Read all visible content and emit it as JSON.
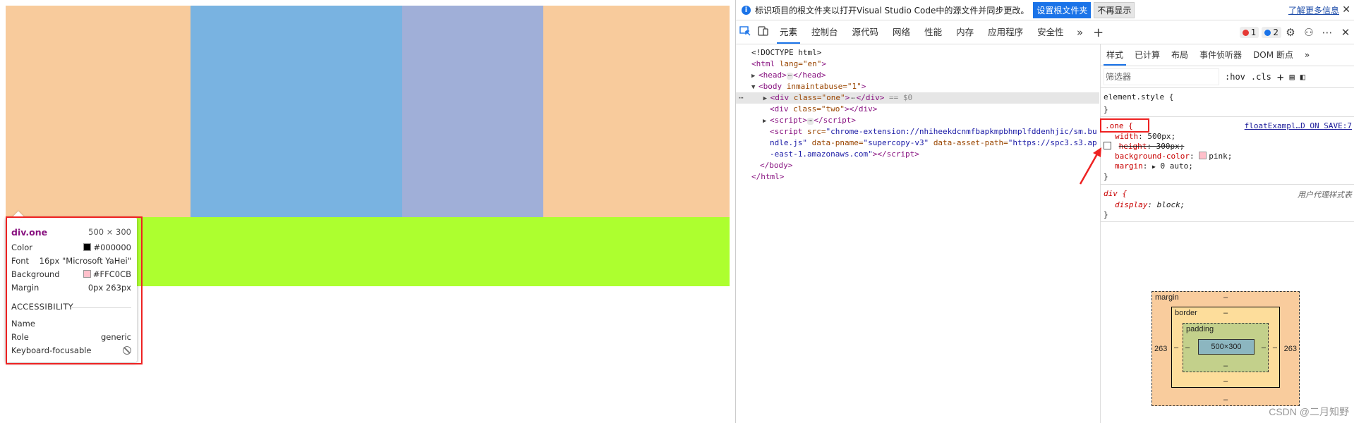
{
  "preview": {
    "tooltip": {
      "selector": "div.one",
      "size": "500 × 300",
      "rows": [
        {
          "label": "Color",
          "value": "#000000",
          "swatch": "#000000"
        },
        {
          "label": "Font",
          "value": "16px \"Microsoft YaHei\""
        },
        {
          "label": "Background",
          "value": "#FFC0CB",
          "swatch": "#FFC0CB"
        },
        {
          "label": "Margin",
          "value": "0px 263px"
        }
      ],
      "accessibility_title": "ACCESSIBILITY",
      "a11y": [
        {
          "label": "Name",
          "value": ""
        },
        {
          "label": "Role",
          "value": "generic"
        },
        {
          "label": "Keyboard-focusable",
          "value": ""
        }
      ]
    },
    "colors": {
      "margin": "#f8cb9c",
      "content": "#79b3e1",
      "padding": "#a0afd8",
      "two": "#adff2f"
    }
  },
  "infobar": {
    "message": "标识项目的根文件夹以打开Visual Studio Code中的源文件并同步更改。",
    "set_root_button": "设置根文件夹",
    "dismiss_button": "不再显示",
    "learn_more": "了解更多信息",
    "close": "✕"
  },
  "tabs": [
    "元素",
    "控制台",
    "源代码",
    "网络",
    "性能",
    "内存",
    "应用程序",
    "安全性"
  ],
  "active_tab": "元素",
  "badges": {
    "errors": "1",
    "messages": "2"
  },
  "dom": [
    {
      "text": "<!DOCTYPE html>"
    },
    {
      "tag": "html",
      "attrs": "lang=\"en\""
    },
    {
      "tag": "head"
    },
    {
      "tag": "body",
      "attrs": "inmaintabuse=\"1\""
    },
    {
      "tag": "div",
      "attrs": "class=\"one\"",
      "suffix": "== $0"
    },
    {
      "tag": "div",
      "attrs": "class=\"two\""
    },
    {
      "tag": "script"
    },
    {
      "script_src": "chrome-extension://nhiheekdcnmfbapkmpbhmplfddenhjic/sm.bundle.js",
      "script_src_line1": "\"chrome-extension://nhiheekdcnmfbapkmpbhmplfddenhjic/sm.bu",
      "script_src_line2": "ndle.js\"",
      "pname": "\"supercopy-v3\"",
      "asset_path_line1": "\"https://spc3.s3.ap",
      "asset_path_line2": "-east-1.amazonaws.com\""
    },
    {
      "close": "</body>"
    },
    {
      "close": "</html>"
    }
  ],
  "style_tabs": [
    "样式",
    "已计算",
    "布局",
    "事件侦听器",
    "DOM 断点"
  ],
  "filter_placeholder": "筛选器",
  "filter_buttons": [
    ":hov",
    ".cls"
  ],
  "rules": {
    "element_style": "element.style {",
    "one": {
      "selector": ".one {",
      "source": "floatExampl…D ON SAVE:7",
      "props": [
        {
          "name": "width",
          "value": "500px;"
        },
        {
          "name": "height",
          "value": "300px;"
        },
        {
          "name": "background-color",
          "value": "pink;"
        },
        {
          "name": "margin",
          "value": "0 auto;"
        }
      ]
    },
    "ua": {
      "selector": "div {",
      "source": "用户代理样式表",
      "prop": "display",
      "value": "block;"
    }
  },
  "boxmodel": {
    "margin_label": "margin",
    "border_label": "border",
    "padding_label": "padding",
    "margin_left": "263",
    "margin_right": "263",
    "dash": "–",
    "content": "500×300"
  },
  "watermark": "CSDN @二月知野"
}
